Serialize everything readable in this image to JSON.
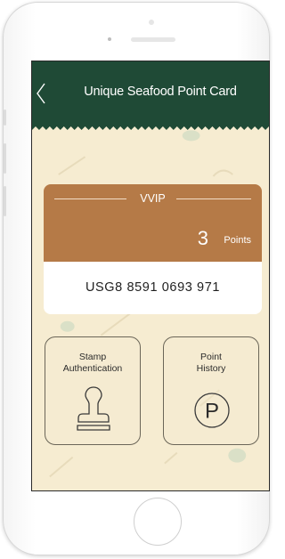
{
  "header": {
    "title": "Unique Seafood Point Card"
  },
  "card": {
    "tier": "VVIP",
    "points": "3",
    "points_unit": "Points",
    "number": "USG8 8591 0693 971"
  },
  "actions": [
    {
      "line1": "Stamp",
      "line2": "Authentication",
      "icon": "stamp-icon"
    },
    {
      "line1": "Point",
      "line2": "History",
      "icon": "parking-p-icon",
      "icon_letter": "P"
    }
  ],
  "colors": {
    "header_bg": "#1f4a36",
    "screen_bg": "#f6ecd1",
    "card_top": "#b57a47",
    "card_bottom": "#ffffff"
  }
}
